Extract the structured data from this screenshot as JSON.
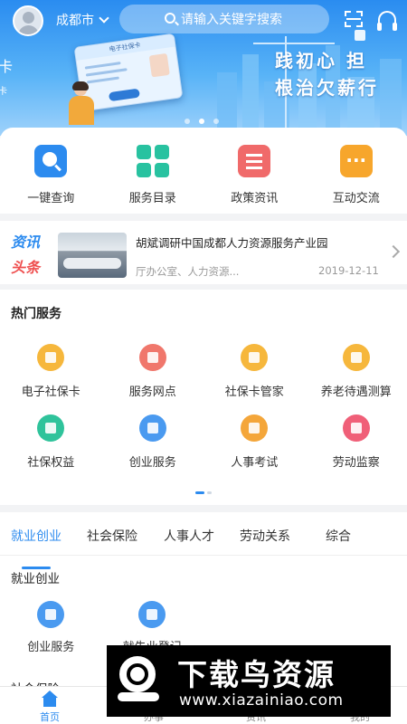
{
  "header": {
    "city": "成都市",
    "search_placeholder": "请输入关键字搜索"
  },
  "banner": {
    "slogan_line1": "践初心  担",
    "slogan_line2": "根治欠薪行",
    "left_edge_line1": "卡",
    "left_edge_line2": "卡",
    "card_title": "电子社保卡",
    "active_slide": 1,
    "slide_count": 3
  },
  "quick_actions": [
    {
      "label": "一键查询",
      "icon": "search-icon"
    },
    {
      "label": "服务目录",
      "icon": "grid-icon"
    },
    {
      "label": "政策资讯",
      "icon": "document-icon"
    },
    {
      "label": "互动交流",
      "icon": "chat-icon"
    }
  ],
  "news": {
    "logo_top": "资讯",
    "logo_bottom": "头条",
    "title": "胡斌调研中国成都人力资源服务产业园",
    "source": "厅办公室、人力资源...",
    "date": "2019-12-11"
  },
  "hot_services": {
    "heading": "热门服务",
    "items": [
      {
        "label": "电子社保卡",
        "icon": "id-card-icon",
        "color": "#f6b73c"
      },
      {
        "label": "服务网点",
        "icon": "location-icon",
        "color": "#f0776c"
      },
      {
        "label": "社保卡管家",
        "icon": "card-manager-icon",
        "color": "#f6b73c"
      },
      {
        "label": "养老待遇测算",
        "icon": "box-icon",
        "color": "#f6b73c"
      },
      {
        "label": "社保权益",
        "icon": "badge-icon",
        "color": "#2fc39b"
      },
      {
        "label": "创业服务",
        "icon": "tie-icon",
        "color": "#4a9af0"
      },
      {
        "label": "人事考试",
        "icon": "exam-icon",
        "color": "#f4a63a"
      },
      {
        "label": "劳动监察",
        "icon": "inspect-icon",
        "color": "#f05f78"
      }
    ]
  },
  "tabs": {
    "items": [
      "就业创业",
      "社会保险",
      "人事人才",
      "劳动关系",
      "综合"
    ],
    "active_index": 0
  },
  "tab_content": {
    "section1_title": "就业创业",
    "items": [
      {
        "label": "创业服务",
        "icon": "tie-icon",
        "color": "#4a9af0"
      },
      {
        "label": "就失业登记",
        "icon": "briefcase-icon",
        "color": "#4a9af0"
      }
    ],
    "section2_title": "社会保险"
  },
  "bottom_nav": {
    "items": [
      "首页",
      "办事",
      "资讯",
      "我的"
    ],
    "active_index": 0
  },
  "watermark": {
    "brand": "下载鸟资源",
    "url": "www.xiazainiao.com"
  }
}
